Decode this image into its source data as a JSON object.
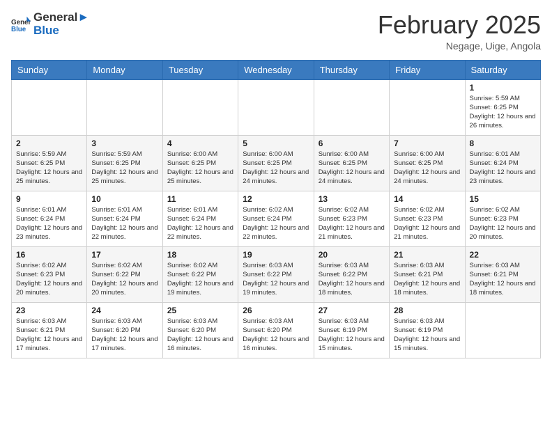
{
  "header": {
    "logo": {
      "general": "General",
      "blue": "Blue"
    },
    "title": "February 2025",
    "subtitle": "Negage, Uige, Angola"
  },
  "calendar": {
    "days_of_week": [
      "Sunday",
      "Monday",
      "Tuesday",
      "Wednesday",
      "Thursday",
      "Friday",
      "Saturday"
    ],
    "weeks": [
      [
        {
          "day": "",
          "info": ""
        },
        {
          "day": "",
          "info": ""
        },
        {
          "day": "",
          "info": ""
        },
        {
          "day": "",
          "info": ""
        },
        {
          "day": "",
          "info": ""
        },
        {
          "day": "",
          "info": ""
        },
        {
          "day": "1",
          "info": "Sunrise: 5:59 AM\nSunset: 6:25 PM\nDaylight: 12 hours and 26 minutes."
        }
      ],
      [
        {
          "day": "2",
          "info": "Sunrise: 5:59 AM\nSunset: 6:25 PM\nDaylight: 12 hours and 25 minutes."
        },
        {
          "day": "3",
          "info": "Sunrise: 5:59 AM\nSunset: 6:25 PM\nDaylight: 12 hours and 25 minutes."
        },
        {
          "day": "4",
          "info": "Sunrise: 6:00 AM\nSunset: 6:25 PM\nDaylight: 12 hours and 25 minutes."
        },
        {
          "day": "5",
          "info": "Sunrise: 6:00 AM\nSunset: 6:25 PM\nDaylight: 12 hours and 24 minutes."
        },
        {
          "day": "6",
          "info": "Sunrise: 6:00 AM\nSunset: 6:25 PM\nDaylight: 12 hours and 24 minutes."
        },
        {
          "day": "7",
          "info": "Sunrise: 6:00 AM\nSunset: 6:25 PM\nDaylight: 12 hours and 24 minutes."
        },
        {
          "day": "8",
          "info": "Sunrise: 6:01 AM\nSunset: 6:24 PM\nDaylight: 12 hours and 23 minutes."
        }
      ],
      [
        {
          "day": "9",
          "info": "Sunrise: 6:01 AM\nSunset: 6:24 PM\nDaylight: 12 hours and 23 minutes."
        },
        {
          "day": "10",
          "info": "Sunrise: 6:01 AM\nSunset: 6:24 PM\nDaylight: 12 hours and 22 minutes."
        },
        {
          "day": "11",
          "info": "Sunrise: 6:01 AM\nSunset: 6:24 PM\nDaylight: 12 hours and 22 minutes."
        },
        {
          "day": "12",
          "info": "Sunrise: 6:02 AM\nSunset: 6:24 PM\nDaylight: 12 hours and 22 minutes."
        },
        {
          "day": "13",
          "info": "Sunrise: 6:02 AM\nSunset: 6:23 PM\nDaylight: 12 hours and 21 minutes."
        },
        {
          "day": "14",
          "info": "Sunrise: 6:02 AM\nSunset: 6:23 PM\nDaylight: 12 hours and 21 minutes."
        },
        {
          "day": "15",
          "info": "Sunrise: 6:02 AM\nSunset: 6:23 PM\nDaylight: 12 hours and 20 minutes."
        }
      ],
      [
        {
          "day": "16",
          "info": "Sunrise: 6:02 AM\nSunset: 6:23 PM\nDaylight: 12 hours and 20 minutes."
        },
        {
          "day": "17",
          "info": "Sunrise: 6:02 AM\nSunset: 6:22 PM\nDaylight: 12 hours and 20 minutes."
        },
        {
          "day": "18",
          "info": "Sunrise: 6:02 AM\nSunset: 6:22 PM\nDaylight: 12 hours and 19 minutes."
        },
        {
          "day": "19",
          "info": "Sunrise: 6:03 AM\nSunset: 6:22 PM\nDaylight: 12 hours and 19 minutes."
        },
        {
          "day": "20",
          "info": "Sunrise: 6:03 AM\nSunset: 6:22 PM\nDaylight: 12 hours and 18 minutes."
        },
        {
          "day": "21",
          "info": "Sunrise: 6:03 AM\nSunset: 6:21 PM\nDaylight: 12 hours and 18 minutes."
        },
        {
          "day": "22",
          "info": "Sunrise: 6:03 AM\nSunset: 6:21 PM\nDaylight: 12 hours and 18 minutes."
        }
      ],
      [
        {
          "day": "23",
          "info": "Sunrise: 6:03 AM\nSunset: 6:21 PM\nDaylight: 12 hours and 17 minutes."
        },
        {
          "day": "24",
          "info": "Sunrise: 6:03 AM\nSunset: 6:20 PM\nDaylight: 12 hours and 17 minutes."
        },
        {
          "day": "25",
          "info": "Sunrise: 6:03 AM\nSunset: 6:20 PM\nDaylight: 12 hours and 16 minutes."
        },
        {
          "day": "26",
          "info": "Sunrise: 6:03 AM\nSunset: 6:20 PM\nDaylight: 12 hours and 16 minutes."
        },
        {
          "day": "27",
          "info": "Sunrise: 6:03 AM\nSunset: 6:19 PM\nDaylight: 12 hours and 15 minutes."
        },
        {
          "day": "28",
          "info": "Sunrise: 6:03 AM\nSunset: 6:19 PM\nDaylight: 12 hours and 15 minutes."
        },
        {
          "day": "",
          "info": ""
        }
      ]
    ]
  }
}
